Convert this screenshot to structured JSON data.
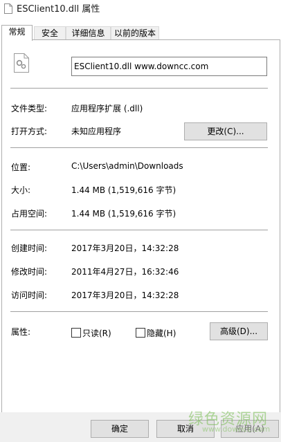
{
  "window": {
    "title": "ESClient10.dll 属性"
  },
  "tabs": [
    "常规",
    "安全",
    "详细信息",
    "以前的版本"
  ],
  "file": {
    "name": "ESClient10.dll      www.downcc.com"
  },
  "props": {
    "type_label": "文件类型:",
    "type_value": "应用程序扩展 (.dll)",
    "open_label": "打开方式:",
    "open_value": "未知应用程序",
    "change_button": "更改(C)...",
    "location_label": "位置:",
    "location_value": "C:\\Users\\admin\\Downloads",
    "size_label": "大小:",
    "size_value": "1.44 MB (1,519,616 字节)",
    "disk_label": "占用空间:",
    "disk_value": "1.44 MB (1,519,616 字节)",
    "created_label": "创建时间:",
    "created_value": "2017年3月20日，14:32:28",
    "modified_label": "修改时间:",
    "modified_value": "2011年4月27日，16:32:46",
    "accessed_label": "访问时间:",
    "accessed_value": "2017年3月20日，14:32:28",
    "attr_label": "属性:",
    "readonly_label": "只读(R)",
    "hidden_label": "隐藏(H)",
    "advanced_button": "高级(D)..."
  },
  "footer": {
    "ok": "确定",
    "cancel": "取消",
    "apply": "应用(A)"
  },
  "watermark": {
    "text": "绿色资源网",
    "url": "www.downcc.com"
  }
}
